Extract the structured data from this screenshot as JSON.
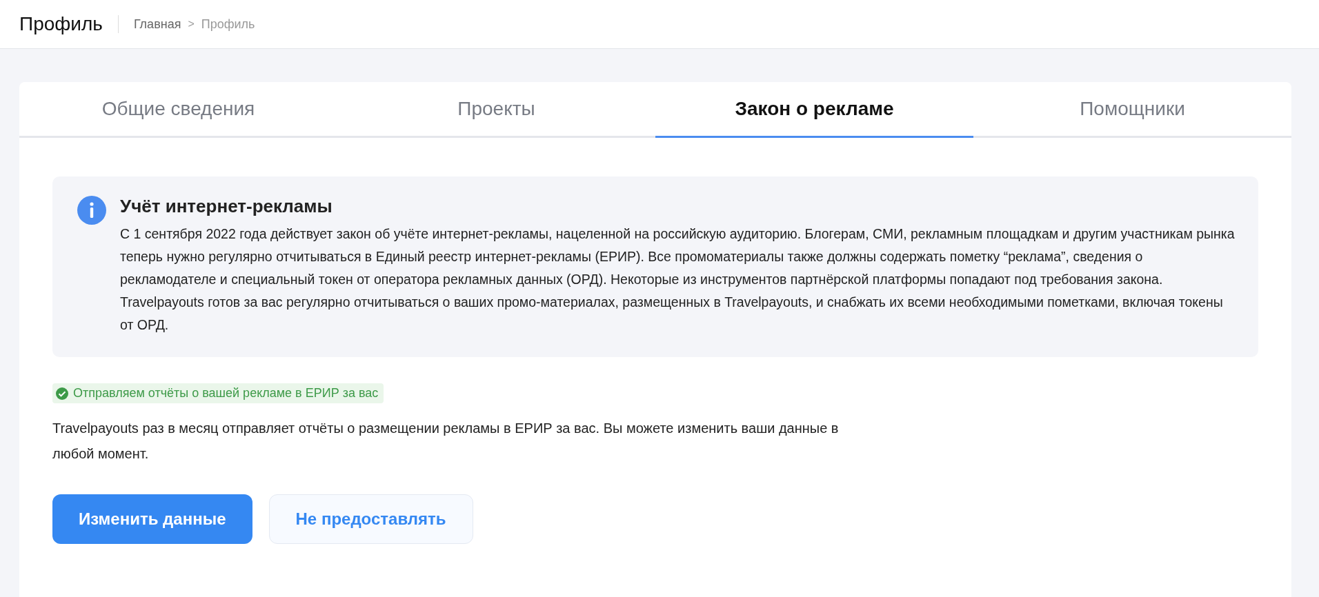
{
  "header": {
    "title": "Профиль",
    "breadcrumbs": [
      {
        "label": "Главная",
        "current": false
      },
      {
        "label": "Профиль",
        "current": true
      }
    ],
    "separator": ">"
  },
  "tabs": [
    {
      "label": "Общие сведения",
      "selected": false
    },
    {
      "label": "Проекты",
      "selected": false
    },
    {
      "label": "Закон о рекламе",
      "selected": true
    },
    {
      "label": "Помощники",
      "selected": false
    }
  ],
  "notice": {
    "title": "Учёт интернет-рекламы",
    "text": "С 1 сентября 2022 года действует закон об учёте интернет-рекламы, нацеленной на российскую аудиторию. Блогерам, СМИ, рекламным площадкам и другим участникам рынка теперь нужно регулярно отчитываться в Единый реестр интернет-рекламы (ЕРИР). Все промоматериалы также должны содержать пометку “реклама”, сведения о рекламодателе и специальный токен от оператора рекламных данных (ОРД). Некоторые из инструментов партнёрской платформы попадают под требования закона. Travelpayouts готов за вас регулярно отчитываться о ваших промо-материалах, размещенных в Travelpayouts, и снабжать их всеми необходимыми пометками, включая токены от ОРД."
  },
  "status": {
    "label": "Отправляем отчёты о вашей рекламе в ЕРИР за вас"
  },
  "description": "Travelpayouts раз в месяц отправляет отчёты о размещении рекламы в ЕРИР за вас. Вы можете изменить ваши данные в любой момент.",
  "buttons": [
    {
      "label": "Изменить данные",
      "kind": "primary"
    },
    {
      "label": "Не предоставлять",
      "kind": "secondary"
    }
  ]
}
